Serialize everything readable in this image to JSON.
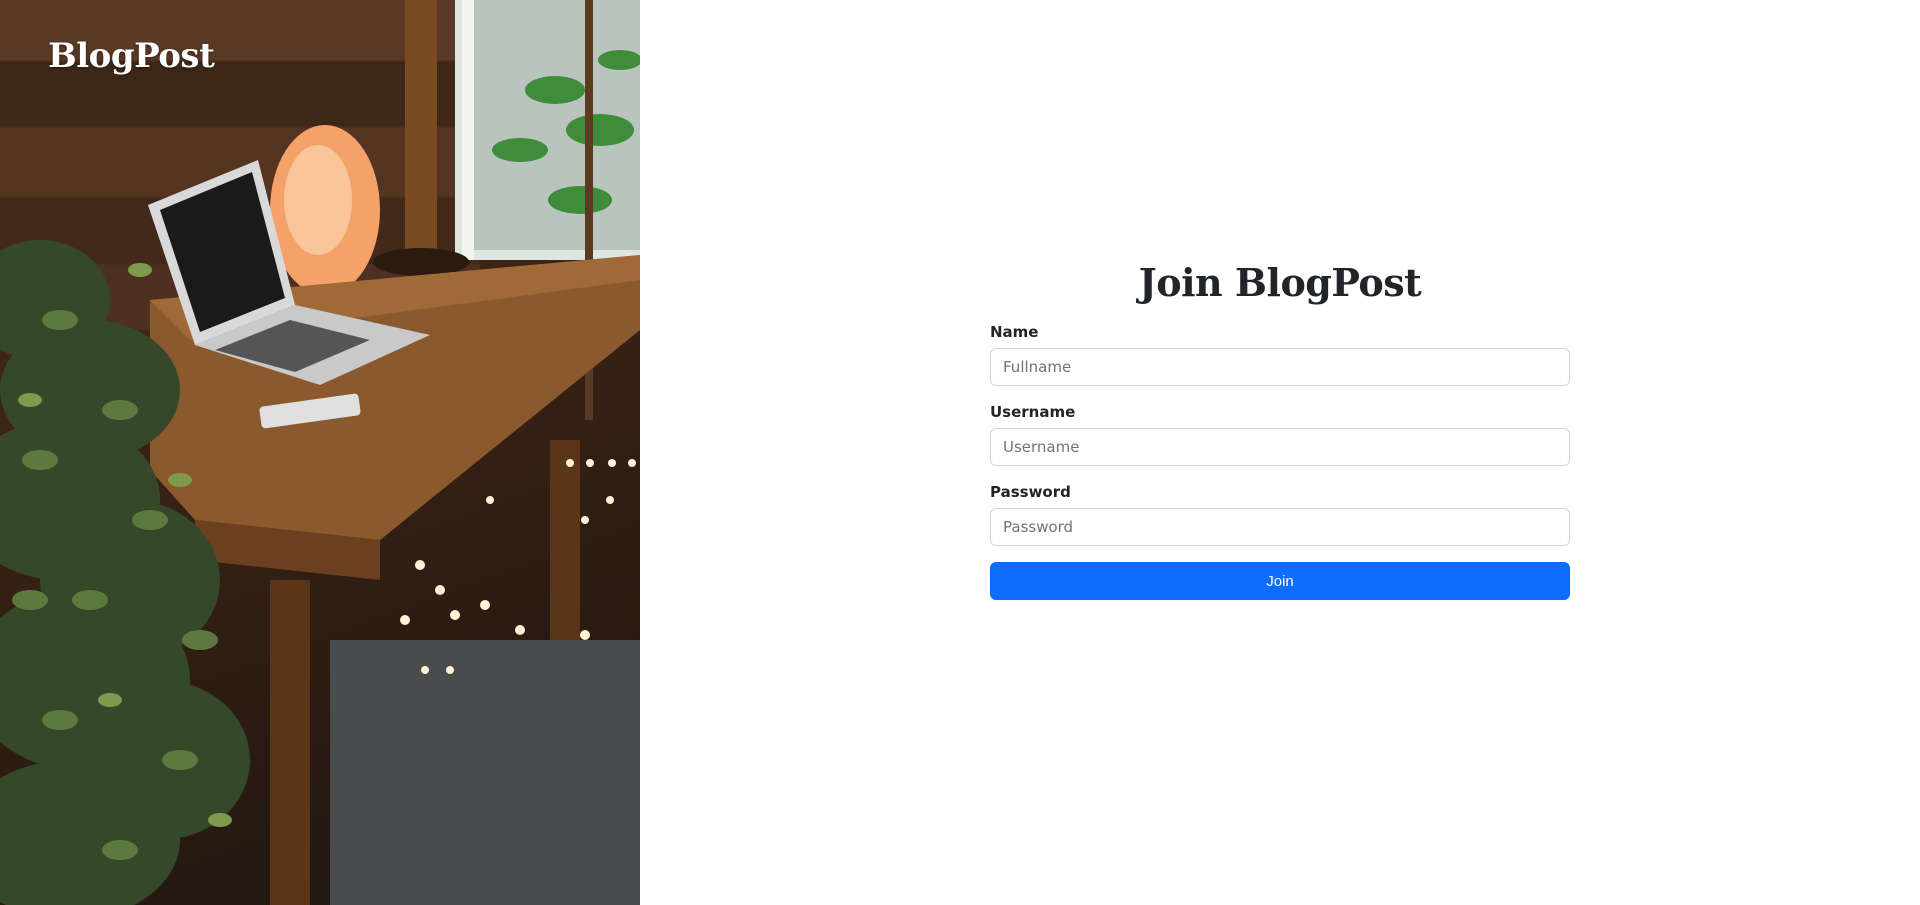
{
  "brand": {
    "name": "BlogPost"
  },
  "photo": {
    "icon": "desk-workspace-photo"
  },
  "form": {
    "title": "Join BlogPost",
    "fields": [
      {
        "label": "Name",
        "placeholder": "Fullname",
        "value": ""
      },
      {
        "label": "Username",
        "placeholder": "Username",
        "value": ""
      },
      {
        "label": "Password",
        "placeholder": "Password",
        "value": ""
      }
    ],
    "submit_label": "Join"
  },
  "colors": {
    "accent": "#0d6efd",
    "text": "#212529",
    "border": "#ced4da"
  }
}
